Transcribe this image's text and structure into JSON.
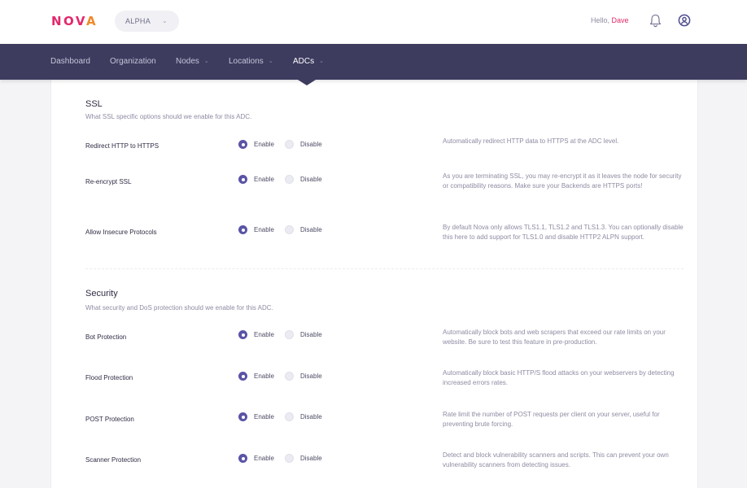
{
  "header": {
    "logo_main": "NOV",
    "logo_accent": "A",
    "environment": "ALPHA",
    "greeting": "Hello,",
    "user_name": "Dave"
  },
  "nav": {
    "items": [
      {
        "label": "Dashboard",
        "has_chevron": false
      },
      {
        "label": "Organization",
        "has_chevron": false
      },
      {
        "label": "Nodes",
        "has_chevron": true
      },
      {
        "label": "Locations",
        "has_chevron": true
      },
      {
        "label": "ADCs",
        "has_chevron": true,
        "active": true
      }
    ]
  },
  "radio_labels": {
    "enable": "Enable",
    "disable": "Disable"
  },
  "ssl": {
    "title": "SSL",
    "description": "What SSL specific options should we enable for this ADC.",
    "rows": [
      {
        "label": "Redirect HTTP to HTTPS",
        "value": "Enable",
        "help": "Automatically redirect HTTP data to HTTPS at the ADC level."
      },
      {
        "label": "Re-encrypt SSL",
        "value": "Enable",
        "help": "As you are terminating SSL, you may re-encrypt it as it leaves the node for security or compatibility reasons. Make sure your Backends are HTTPS ports!"
      },
      {
        "label": "Allow Insecure Protocols",
        "value": "Enable",
        "help": "By default Nova only allows TLS1.1, TLS1.2 and TLS1.3. You can optionally disable this here to add support for TLS1.0 and disable HTTP2 ALPN support."
      }
    ]
  },
  "security": {
    "title": "Security",
    "description": "What security and DoS protection should we enable for this ADC.",
    "rows": [
      {
        "label": "Bot Protection",
        "value": "Enable",
        "help": "Automatically block bots and web scrapers that exceed our rate limits on your website. Be sure to test this feature in pre-production."
      },
      {
        "label": "Flood Protection",
        "value": "Enable",
        "help": "Automatically block basic HTTP/S flood attacks on your webservers by detecting increased errors rates."
      },
      {
        "label": "POST Protection",
        "value": "Enable",
        "help": "Rate limit the number of POST requests per client on your server, useful for preventing brute forcing."
      },
      {
        "label": "Scanner Protection",
        "value": "Enable",
        "help": "Detect and block vulnerability scanners and scripts. This can prevent your own vulnerability scanners from detecting issues."
      }
    ]
  },
  "colors": {
    "brand_pink": "#e3286b",
    "brand_orange": "#f08a2a",
    "nav_bg": "#3d3b5e",
    "radio_on": "#5a54a6"
  },
  "icons": {
    "notifications": "bell-icon",
    "account": "user-circle-icon",
    "dropdown": "chevron-down-icon"
  }
}
